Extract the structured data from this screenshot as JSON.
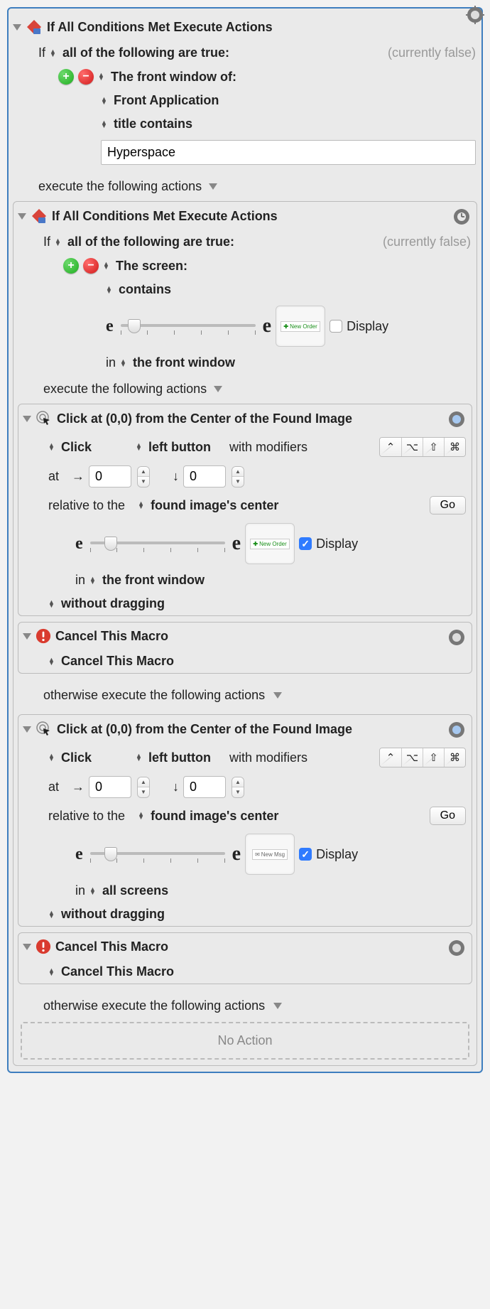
{
  "outer": {
    "title": "If All Conditions Met Execute Actions",
    "if_label": "If",
    "match_mode": "all of the following are true:",
    "status": "(currently false)",
    "cond": {
      "target": "The front window of:",
      "app": "Front Application",
      "attr": "title contains",
      "value": "Hyperspace"
    },
    "execute_label": "execute the following actions"
  },
  "inner_if": {
    "title": "If All Conditions Met Execute Actions",
    "if_label": "If",
    "match_mode": "all of the following are true:",
    "status": "(currently false)",
    "cond": {
      "target": "The screen:",
      "attr": "contains",
      "image_tag": "New Order",
      "display_check": false,
      "display_label": "Display",
      "in_label": "in",
      "scope": "the front window"
    },
    "execute_label": "execute the following actions"
  },
  "click1": {
    "title": "Click at (0,0) from the Center of the Found Image",
    "click_label": "Click",
    "button": "left button",
    "with_mod": "with modifiers",
    "at": "at",
    "x": "0",
    "y": "0",
    "rel_label": "relative to the",
    "rel_target": "found image's center",
    "go": "Go",
    "image_tag": "New Order",
    "display_check": true,
    "display_label": "Display",
    "in_label": "in",
    "scope": "the front window",
    "drag": "without dragging"
  },
  "cancel1": {
    "title": "Cancel This Macro",
    "opt": "Cancel This Macro"
  },
  "otherwise1": "otherwise execute the following actions",
  "click2": {
    "title": "Click at (0,0) from the Center of the Found Image",
    "click_label": "Click",
    "button": "left button",
    "with_mod": "with modifiers",
    "at": "at",
    "x": "0",
    "y": "0",
    "rel_label": "relative to the",
    "rel_target": "found image's center",
    "go": "Go",
    "image_tag": "New Msg",
    "display_check": true,
    "display_label": "Display",
    "in_label": "in",
    "scope": "all screens",
    "drag": "without dragging"
  },
  "cancel2": {
    "title": "Cancel This Macro",
    "opt": "Cancel This Macro"
  },
  "otherwise2": "otherwise execute the following actions",
  "no_action": "No Action",
  "modifiers": [
    "⌃",
    "⌥",
    "⇧",
    "⌘"
  ]
}
